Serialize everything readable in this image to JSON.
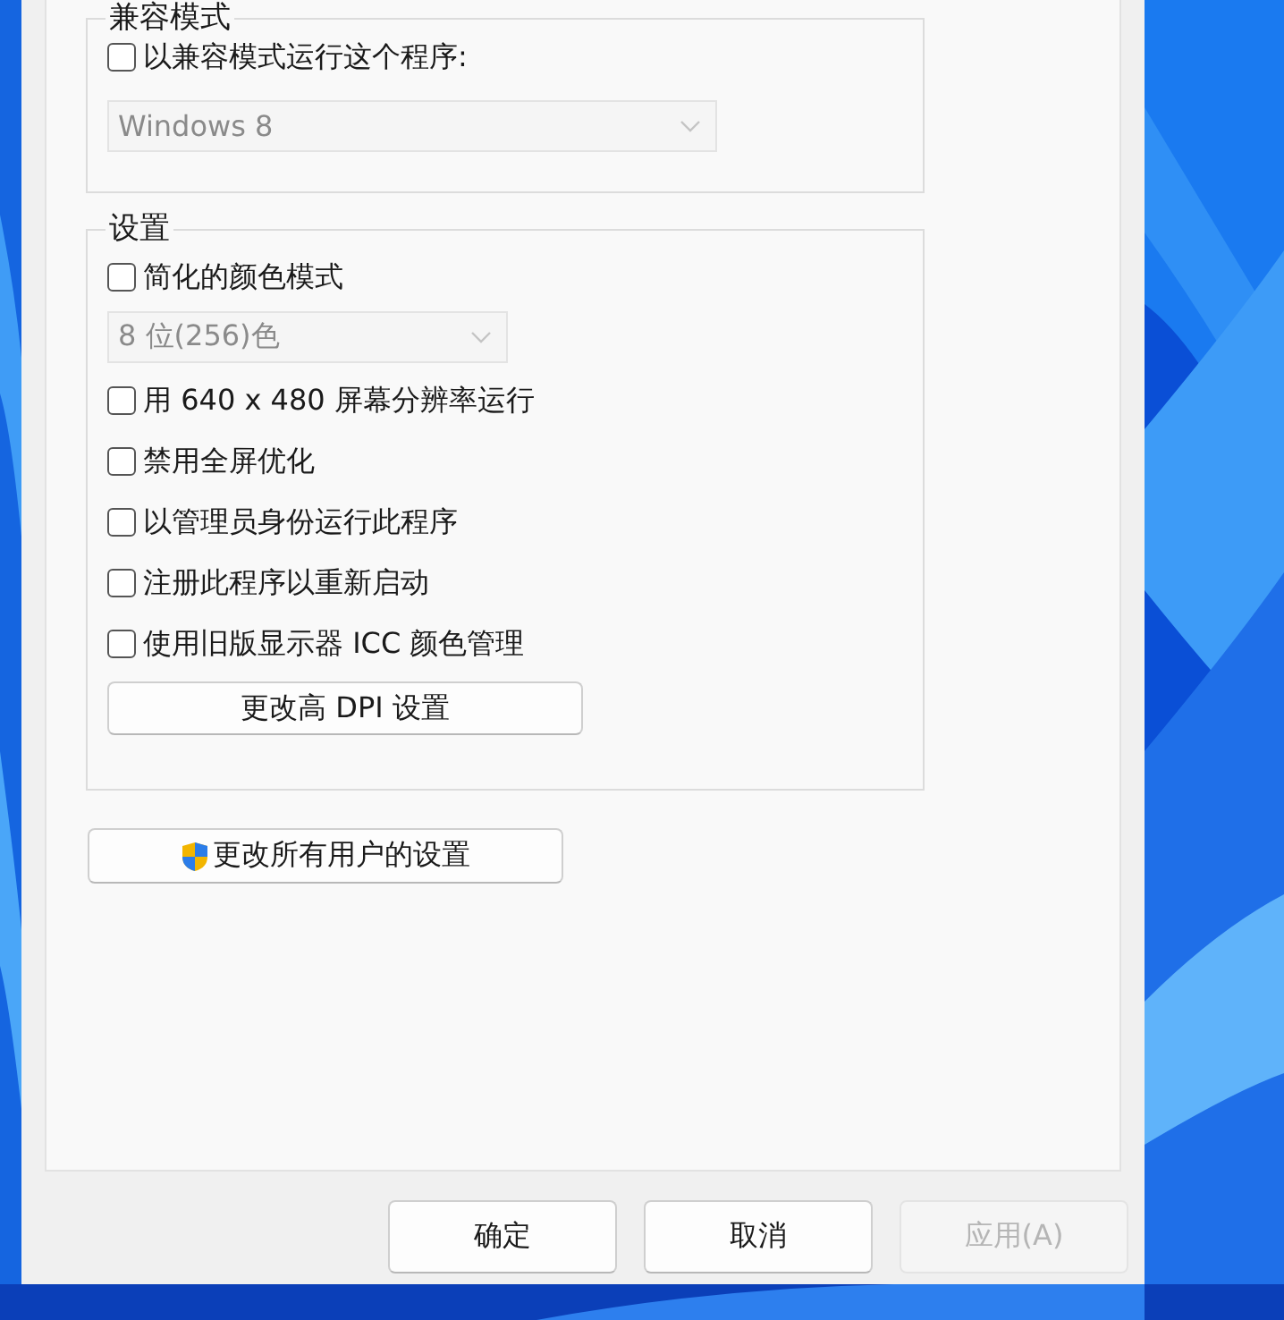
{
  "compatibility_mode": {
    "title": "兼容模式",
    "checkbox": {
      "label": "以兼容模式运行这个程序:",
      "checked": false
    },
    "dropdown": {
      "value": "Windows 8",
      "disabled": true
    }
  },
  "settings": {
    "title": "设置",
    "items": [
      {
        "kind": "checkbox",
        "label": "简化的颜色模式",
        "checked": false
      },
      {
        "kind": "dropdown",
        "value": "8 位(256)色",
        "disabled": true
      },
      {
        "kind": "checkbox",
        "label": "用 640 x 480 屏幕分辨率运行",
        "checked": false
      },
      {
        "kind": "checkbox",
        "label": "禁用全屏优化",
        "checked": false
      },
      {
        "kind": "checkbox",
        "label": "以管理员身份运行此程序",
        "checked": false
      },
      {
        "kind": "checkbox",
        "label": "注册此程序以重新启动",
        "checked": false
      },
      {
        "kind": "checkbox",
        "label": "使用旧版显示器 ICC 颜色管理",
        "checked": false
      },
      {
        "kind": "button",
        "label": "更改高 DPI 设置"
      }
    ]
  },
  "all_users_button": {
    "label": "更改所有用户的设置"
  },
  "buttons": [
    {
      "label": "确定",
      "disabled": false
    },
    {
      "label": "取消",
      "disabled": false
    },
    {
      "label": "应用(A)",
      "disabled": true
    }
  ]
}
